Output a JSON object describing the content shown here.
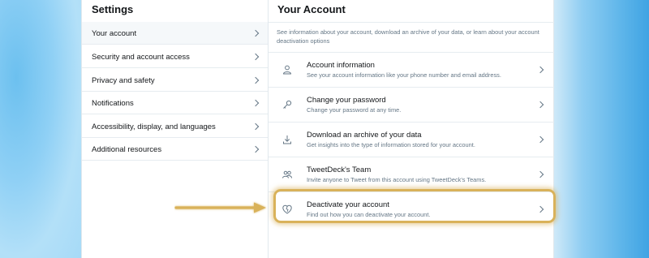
{
  "settings": {
    "title": "Settings",
    "items": [
      {
        "label": "Your account",
        "active": true
      },
      {
        "label": "Security and account access",
        "active": false
      },
      {
        "label": "Privacy and safety",
        "active": false
      },
      {
        "label": "Notifications",
        "active": false
      },
      {
        "label": "Accessibility, display, and languages",
        "active": false
      },
      {
        "label": "Additional resources",
        "active": false
      }
    ]
  },
  "account": {
    "title": "Your Account",
    "intro": "See information about your account, download an archive of your data, or learn about your account deactivation options",
    "rows": [
      {
        "title": "Account information",
        "desc": "See your account information like your phone number and email address.",
        "icon": "user-icon"
      },
      {
        "title": "Change your password",
        "desc": "Change your password at any time.",
        "icon": "key-icon"
      },
      {
        "title": "Download an archive of your data",
        "desc": "Get insights into the type of information stored for your account.",
        "icon": "download-icon"
      },
      {
        "title": "TweetDeck's Team",
        "desc": "Invite anyone to Tweet from this account using TweetDeck's Teams.",
        "icon": "team-icon"
      },
      {
        "title": "Deactivate your account",
        "desc": "Find out how you can deactivate your account.",
        "icon": "broken-heart-icon"
      }
    ]
  },
  "colors": {
    "highlight": "#d9b25a",
    "text_primary": "#14171a",
    "text_secondary": "#657786"
  }
}
